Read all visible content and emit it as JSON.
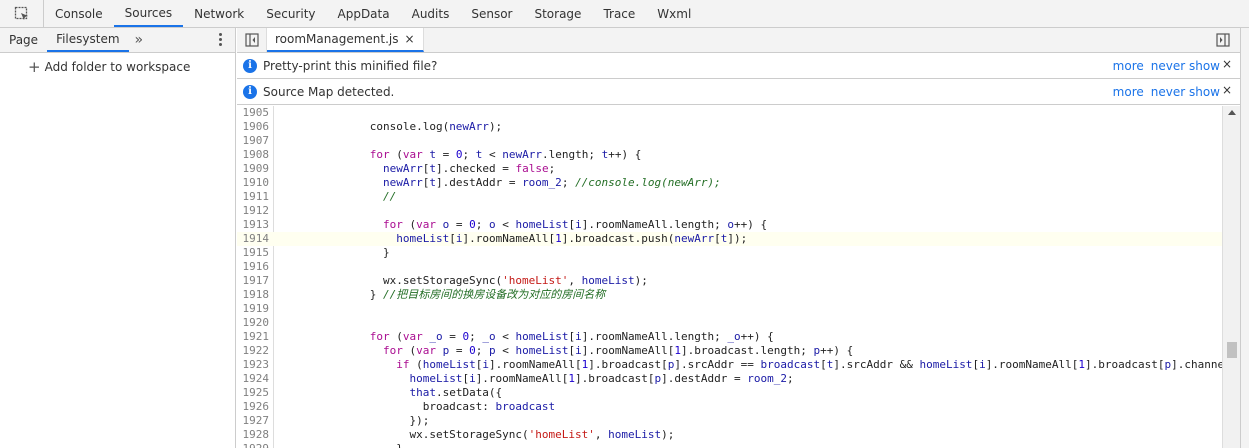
{
  "top_tabs": [
    "Console",
    "Sources",
    "Network",
    "Security",
    "AppData",
    "Audits",
    "Sensor",
    "Storage",
    "Trace",
    "Wxml"
  ],
  "navigator": {
    "tabs": [
      "Page",
      "Filesystem"
    ],
    "more_label": "»",
    "add_folder_label": "Add folder to workspace"
  },
  "editor": {
    "file_tab": "roomManagement.js",
    "close_glyph": "×",
    "infobars": [
      {
        "text": "Pretty-print this minified file?",
        "more": "more",
        "never_show": "never show",
        "close": "×"
      },
      {
        "text": "Source Map detected.",
        "more": "more",
        "never_show": "never show",
        "close": "×"
      }
    ]
  },
  "code_lines": [
    {
      "n": "1905",
      "html": ""
    },
    {
      "n": "1906",
      "html": "              console.log(<span class=\"var\">newArr</span>);"
    },
    {
      "n": "1907",
      "html": ""
    },
    {
      "n": "1908",
      "html": "              <span class=\"kw\">for</span> (<span class=\"kw\">var</span> <span class=\"var\">t</span> = <span class=\"num\">0</span>; <span class=\"var\">t</span> &lt; <span class=\"var\">newArr</span>.length; <span class=\"var\">t</span>++) {"
    },
    {
      "n": "1909",
      "html": "                <span class=\"var\">newArr</span>[<span class=\"var\">t</span>].checked = <span class=\"kw\">false</span>;"
    },
    {
      "n": "1910",
      "html": "                <span class=\"var\">newArr</span>[<span class=\"var\">t</span>].destAddr = <span class=\"var\">room_2</span>; <span class=\"cm\">//console.log(newArr);</span>"
    },
    {
      "n": "1911",
      "html": "                <span class=\"cm\">//</span>"
    },
    {
      "n": "1912",
      "html": ""
    },
    {
      "n": "1913",
      "html": "                <span class=\"kw\">for</span> (<span class=\"kw\">var</span> <span class=\"var\">o</span> = <span class=\"num\">0</span>; <span class=\"var\">o</span> &lt; <span class=\"var\">homeList</span>[<span class=\"var\">i</span>].roomNameAll.length; <span class=\"var\">o</span>++) {"
    },
    {
      "n": "1914",
      "html": "                  <span class=\"var\">homeList</span>[<span class=\"var\">i</span>].roomNameAll[<span class=\"num\">1</span>].broadcast.push(<span class=\"var\">newArr</span>[<span class=\"var\">t</span>]);",
      "current": true
    },
    {
      "n": "1915",
      "html": "                }"
    },
    {
      "n": "1916",
      "html": ""
    },
    {
      "n": "1917",
      "html": "                wx.setStorageSync(<span class=\"str\">'homeList'</span>, <span class=\"var\">homeList</span>);"
    },
    {
      "n": "1918",
      "html": "              } <span class=\"cm\">//把目标房间的换房设备改为对应的房间名称</span>"
    },
    {
      "n": "1919",
      "html": ""
    },
    {
      "n": "1920",
      "html": ""
    },
    {
      "n": "1921",
      "html": "              <span class=\"kw\">for</span> (<span class=\"kw\">var</span> <span class=\"var\">_o</span> = <span class=\"num\">0</span>; <span class=\"var\">_o</span> &lt; <span class=\"var\">homeList</span>[<span class=\"var\">i</span>].roomNameAll.length; <span class=\"var\">_o</span>++) {"
    },
    {
      "n": "1922",
      "html": "                <span class=\"kw\">for</span> (<span class=\"kw\">var</span> <span class=\"var\">p</span> = <span class=\"num\">0</span>; <span class=\"var\">p</span> &lt; <span class=\"var\">homeList</span>[<span class=\"var\">i</span>].roomNameAll[<span class=\"num\">1</span>].broadcast.length; <span class=\"var\">p</span>++) {"
    },
    {
      "n": "1923",
      "html": "                  <span class=\"kw\">if</span> (<span class=\"var\">homeList</span>[<span class=\"var\">i</span>].roomNameAll[<span class=\"num\">1</span>].broadcast[<span class=\"var\">p</span>].srcAddr == <span class=\"var\">broadcast</span>[<span class=\"var\">t</span>].srcAddr &amp;&amp; <span class=\"var\">homeList</span>[<span class=\"var\">i</span>].roomNameAll[<span class=\"num\">1</span>].broadcast[<span class=\"var\">p</span>].channel"
    },
    {
      "n": "1924",
      "html": "                    <span class=\"var\">homeList</span>[<span class=\"var\">i</span>].roomNameAll[<span class=\"num\">1</span>].broadcast[<span class=\"var\">p</span>].destAddr = <span class=\"var\">room_2</span>;"
    },
    {
      "n": "1925",
      "html": "                    <span class=\"var\">that</span>.setData({"
    },
    {
      "n": "1926",
      "html": "                      broadcast: <span class=\"var\">broadcast</span>"
    },
    {
      "n": "1927",
      "html": "                    });"
    },
    {
      "n": "1928",
      "html": "                    wx.setStorageSync(<span class=\"str\">'homeList'</span>, <span class=\"var\">homeList</span>);"
    },
    {
      "n": "1929",
      "html": "                  }"
    }
  ]
}
